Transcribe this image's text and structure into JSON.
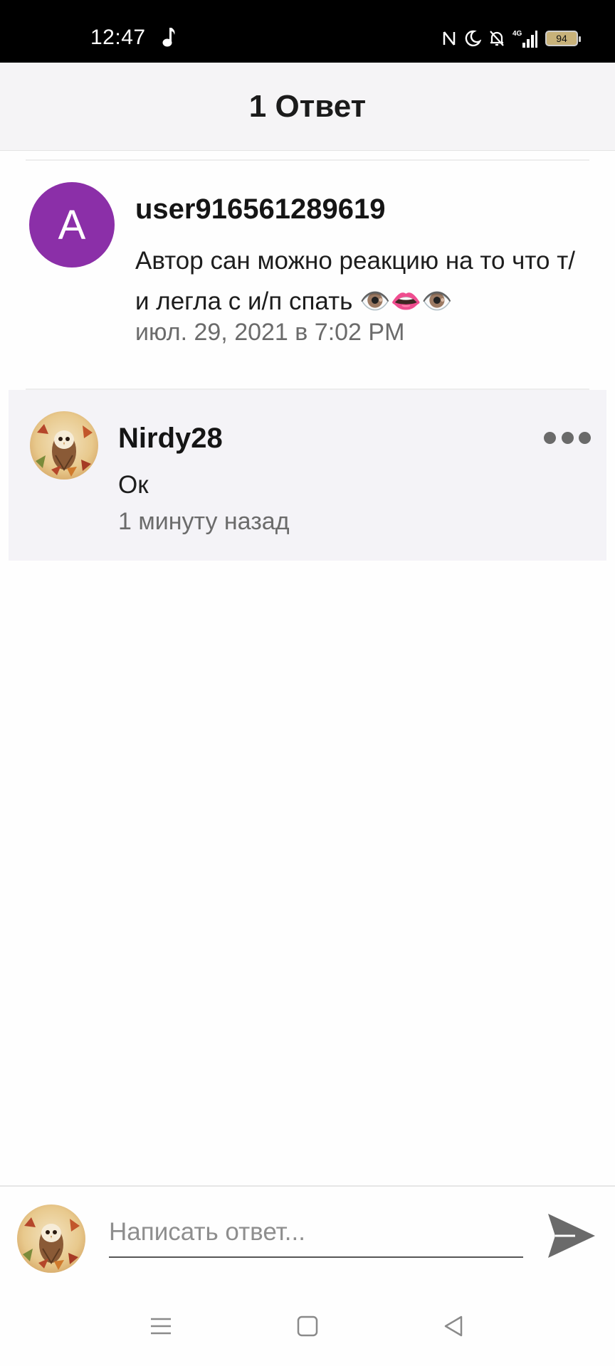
{
  "status_bar": {
    "time": "12:47",
    "battery": "94",
    "icons": [
      "music-note-icon",
      "nfc-icon",
      "do-not-disturb-moon-icon",
      "bell-off-icon",
      "signal-4g-icon",
      "battery-icon"
    ]
  },
  "header": {
    "title": "1 Ответ"
  },
  "original_comment": {
    "avatar_letter": "A",
    "avatar_color": "#8b2fa8",
    "username": "user916561289619",
    "text": "Автор сан можно реакцию на то что т/и легла с и/п спать 👁️👄👁️",
    "date": "июл. 29, 2021 в 7:02 PM"
  },
  "reply": {
    "username": "Nirdy28",
    "text": "Ок",
    "time": "1 минуту назад",
    "avatar": "owl-avatar-icon"
  },
  "compose": {
    "placeholder": "Написать ответ...",
    "value": ""
  },
  "nav_bar": {
    "icons": [
      "menu-icon",
      "home-square-icon",
      "back-triangle-icon"
    ]
  },
  "colors": {
    "header_bg": "#f5f4f6",
    "reply_bg": "#f4f3f7",
    "secondary_text": "#6b6b6b"
  }
}
